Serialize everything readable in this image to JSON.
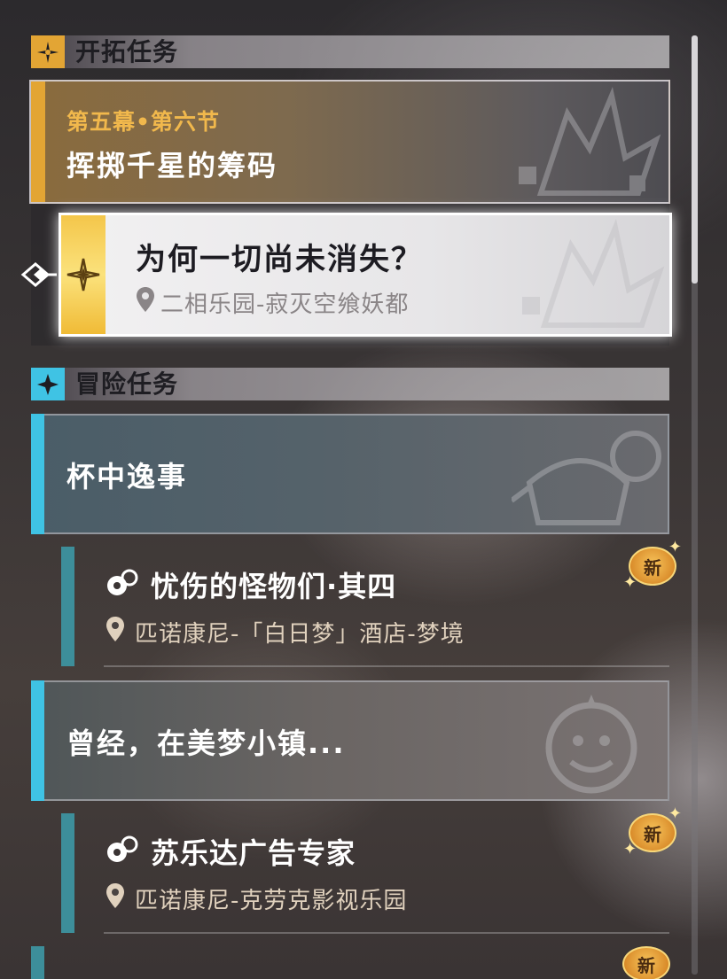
{
  "trailblaze": {
    "header": "开拓任务",
    "group": {
      "chapter": "第五幕•第六节",
      "title": "挥掷千星的筹码"
    },
    "quest": {
      "title": "为何一切尚未消失？",
      "location": "二相乐园-寂灭空飨妖都"
    }
  },
  "adventure": {
    "header": "冒险任务",
    "groups": [
      {
        "title": "杯中逸事",
        "quest": {
          "title": "忧伤的怪物们·其四",
          "location": "匹诺康尼-「白日梦」酒店-梦境",
          "badge": "新"
        }
      },
      {
        "title": "曾经，在美梦小镇...",
        "quest": {
          "title": "苏乐达广告专家",
          "location": "匹诺康尼-克劳克影视乐园",
          "badge": "新"
        }
      }
    ],
    "partial_badge": "新"
  },
  "colors": {
    "trailblaze_accent": "#e3a534",
    "adventure_accent": "#3fc3e4",
    "new_badge": "#f0a93e"
  },
  "icons": {
    "trailblaze": "compass-star-icon",
    "adventure": "four-point-star-icon",
    "location": "location-pin-icon",
    "quest_type": "adventure-quest-icon",
    "selected": "diamond-arrow-icon"
  }
}
